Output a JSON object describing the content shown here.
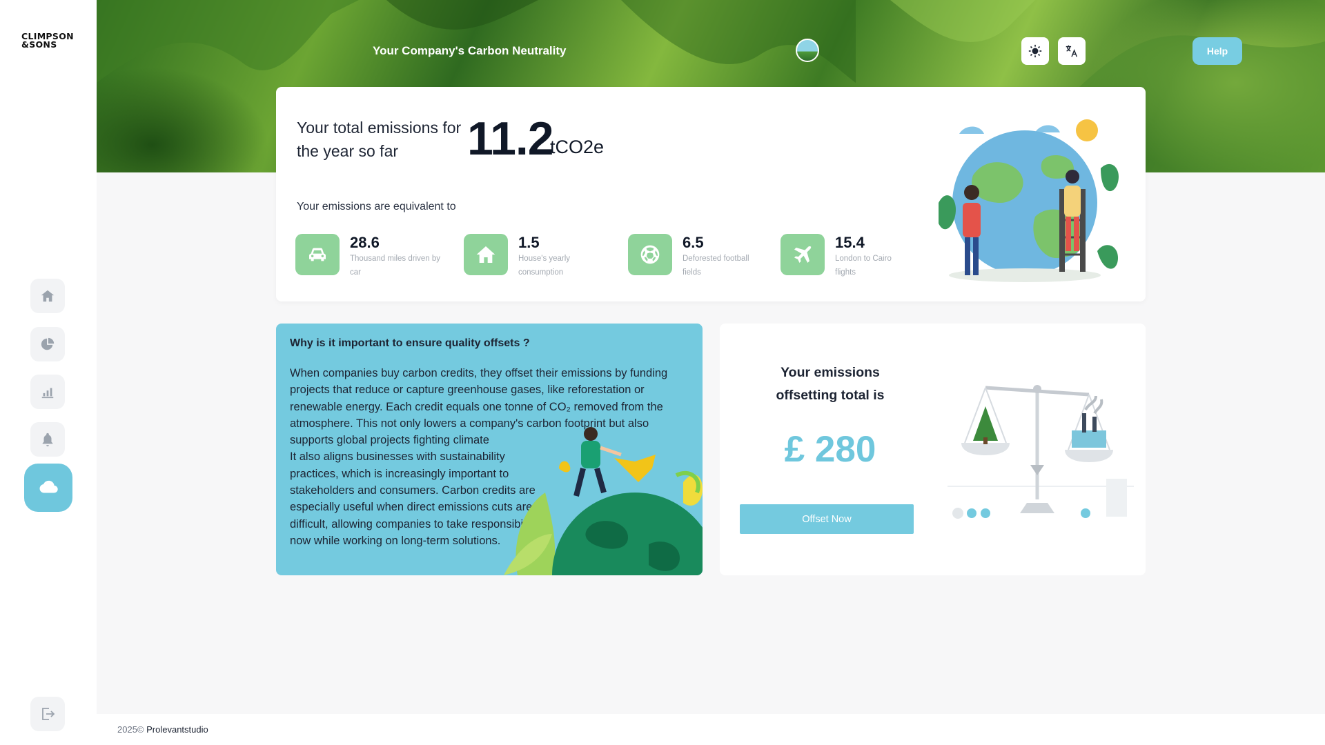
{
  "brand": {
    "logo_line1": "CLIMPSON",
    "logo_line2": "&SONS"
  },
  "sidebar": {
    "items": [
      {
        "icon": "home-icon",
        "active": false
      },
      {
        "icon": "pie-chart-icon",
        "active": false
      },
      {
        "icon": "bar-chart-icon",
        "active": false
      },
      {
        "icon": "bell-icon",
        "active": false
      },
      {
        "icon": "cloud-icon",
        "active": true
      }
    ],
    "logout_icon": "logout-icon"
  },
  "header": {
    "title": "Your Company's Carbon Neutrality",
    "theme_icon": "sun-icon",
    "language_icon": "translate-icon",
    "help_label": "Help"
  },
  "emissions": {
    "label": "Your total emissions for the year so far",
    "value": "11.2",
    "unit": "tCO2e",
    "equivalent_title": "Your emissions are equivalent to",
    "equivalents": [
      {
        "icon": "car-icon",
        "value": "28.6",
        "description": "Thousand miles driven by car"
      },
      {
        "icon": "house-icon",
        "value": "1.5",
        "description": "House's yearly consumption"
      },
      {
        "icon": "football-icon",
        "value": "6.5",
        "description": "Deforested football fields"
      },
      {
        "icon": "plane-icon",
        "value": "15.4",
        "description": "London to Cairo flights"
      }
    ]
  },
  "info": {
    "title": "Why is it important to ensure quality offsets ?",
    "paragraph1": "When companies buy carbon credits, they offset their emissions by funding projects that reduce or capture greenhouse gases, like reforestation or renewable energy. Each credit equals one tonne of CO₂ removed from the atmosphere. This not only lowers a company's carbon footprint but also supports global projects fighting climate",
    "paragraph2": "It also aligns businesses with sustainability practices, which is increasingly important to stakeholders and consumers. Carbon credits are especially useful when direct emissions cuts are difficult, allowing companies to take responsibility now while working on long-term solutions."
  },
  "offset": {
    "title": "Your emissions offsetting total is",
    "amount": "£ 280",
    "button_label": "Offset Now"
  },
  "footer": {
    "year": "2025©",
    "company": "Prolevantstudio"
  },
  "colors": {
    "accent": "#74cadf",
    "equivalent_icon_bg": "#8fd39a",
    "sidebar_active": "#6fc7dd"
  }
}
